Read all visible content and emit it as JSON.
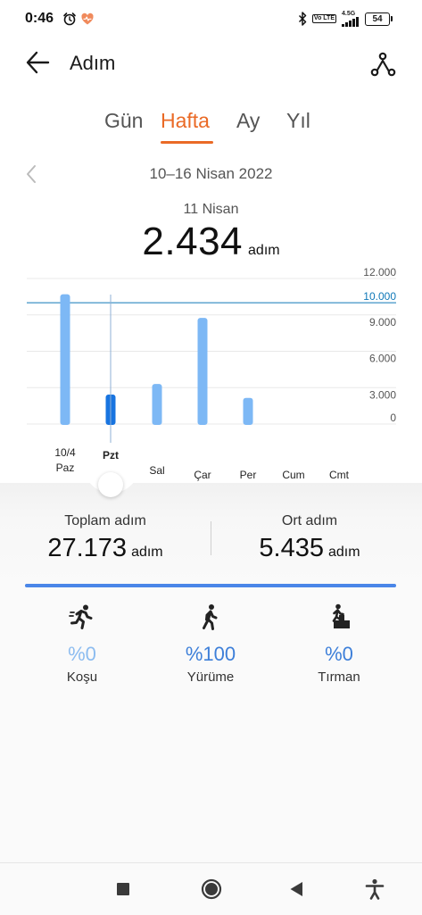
{
  "status_bar": {
    "time": "0:46",
    "net_badge": "Vo LTE",
    "net_speed": "4.5G",
    "battery": "54"
  },
  "header": {
    "title": "Adım",
    "back_icon": "back-arrow-icon",
    "share_icon": "share-icon"
  },
  "tabs": [
    {
      "label": "Gün",
      "active": false
    },
    {
      "label": "Hafta",
      "active": true
    },
    {
      "label": "Ay",
      "active": false
    },
    {
      "label": "Yıl",
      "active": false
    }
  ],
  "date_range": "10–16 Nisan 2022",
  "selected": {
    "day_label": "11 Nisan",
    "value": "2.434",
    "unit": "adım"
  },
  "chart_data": {
    "type": "bar",
    "categories": [
      "Paz",
      "Pzt",
      "Sal",
      "Çar",
      "Per",
      "Cum",
      "Cmt"
    ],
    "date_label": "10/4",
    "values": [
      10700,
      2434,
      3300,
      8750,
      2150,
      0,
      0
    ],
    "selected_index": 1,
    "target": {
      "value": 10000,
      "label": "10.000"
    },
    "ylim": [
      0,
      12000
    ],
    "ticks": [
      {
        "value": 12000,
        "label": "12.000"
      },
      {
        "value": 9000,
        "label": "9.000"
      },
      {
        "value": 6000,
        "label": "6.000"
      },
      {
        "value": 3000,
        "label": "3.000"
      },
      {
        "value": 0,
        "label": "0"
      }
    ],
    "colors": {
      "bar": "#7db8f5",
      "selected_bar": "#1874e0",
      "target_line": "#0f78b8"
    }
  },
  "summary": {
    "total_label": "Toplam adım",
    "total_value": "27.173",
    "total_unit": "adım",
    "avg_label": "Ort adım",
    "avg_value": "5.435",
    "avg_unit": "adım"
  },
  "distribution_progress": 1.0,
  "activities": [
    {
      "name": "Koşu",
      "percent": "%0",
      "icon": "running-icon",
      "color": "#8cbcf0"
    },
    {
      "name": "Yürüme",
      "percent": "%100",
      "icon": "walking-icon",
      "color": "#3d7fd9"
    },
    {
      "name": "Tırman",
      "percent": "%0",
      "icon": "climbing-icon",
      "color": "#3d7fd9"
    }
  ],
  "nav": {
    "recent_icon": "square-icon",
    "home_icon": "circle-icon",
    "back_icon": "triangle-back-icon",
    "accessibility_icon": "accessibility-icon"
  }
}
